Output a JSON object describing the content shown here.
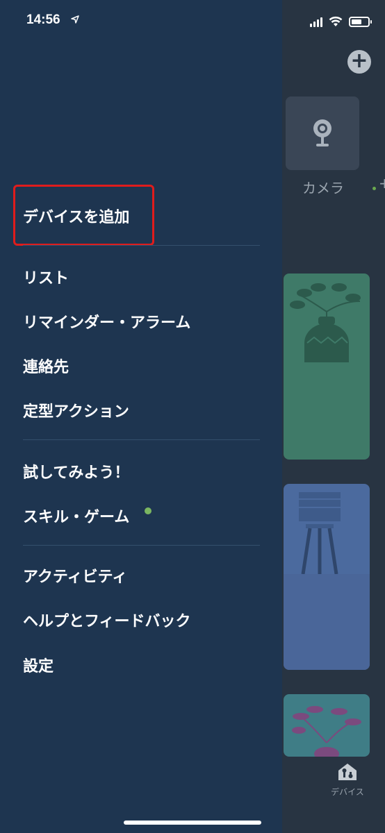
{
  "status_bar": {
    "time": "14:56"
  },
  "background": {
    "camera_label": "カメラ",
    "plus_small": "+",
    "tab_devices_label": "デバイス"
  },
  "menu": {
    "add_device": "デバイスを追加",
    "list": "リスト",
    "reminders_alarms": "リマインダー・アラーム",
    "contacts": "連絡先",
    "routines": "定型アクション",
    "things_to_try": "試してみよう！",
    "skills_games": "スキル・ゲーム",
    "activity": "アクティビティ",
    "help_feedback": "ヘルプとフィードバック",
    "settings": "設定"
  },
  "colors": {
    "drawer": "#1e3550",
    "highlight": "#e01c1c",
    "new_dot": "#7bb661"
  },
  "icons": [
    "location-arrow-icon",
    "signal-icon",
    "wifi-icon",
    "battery-icon",
    "plus-icon",
    "camera-icon",
    "devices-icon"
  ]
}
